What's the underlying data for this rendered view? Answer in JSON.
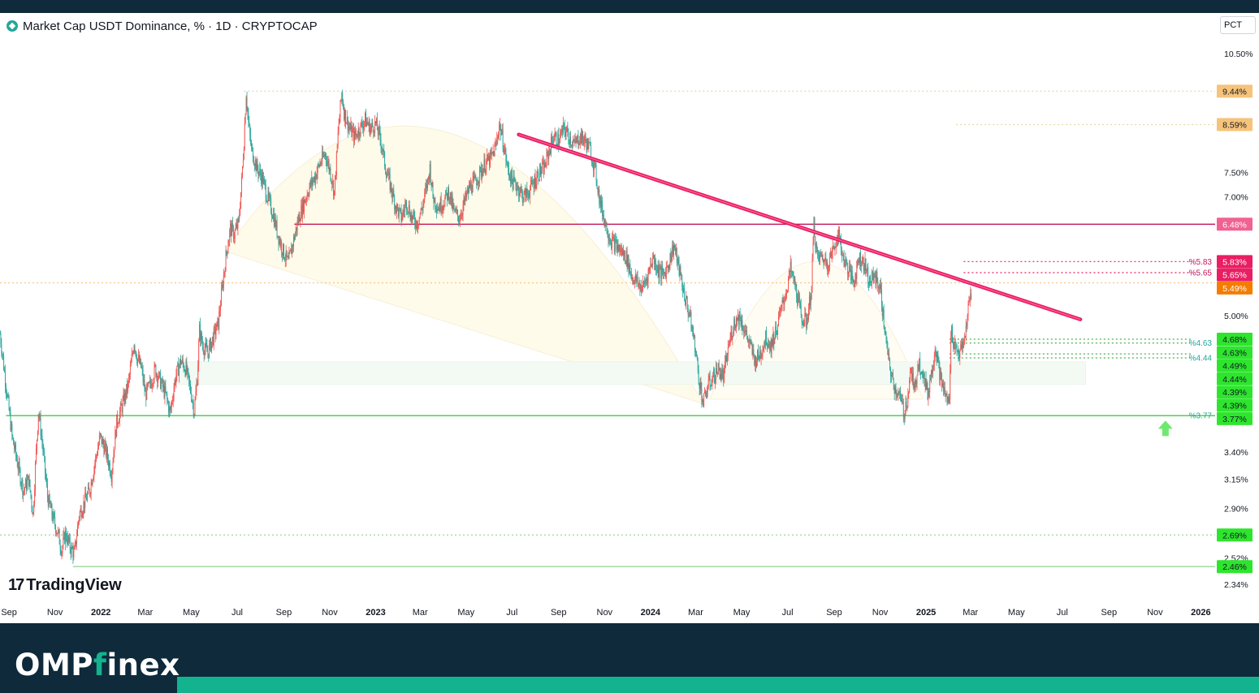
{
  "header": {
    "symbol_title": "Market Cap USDT Dominance, % · 1D · CRYPTOCAP",
    "scale_button": "PCT"
  },
  "watermark": {
    "text": "TradingView"
  },
  "footer": {
    "brand_prefix": "OMP",
    "brand_accent": "f",
    "brand_suffix": "inex"
  },
  "colors": {
    "up": "#26a69a",
    "down": "#ef5350",
    "trendline": "#e91e63",
    "support": "#4caf50",
    "resistance_box": "#c2185b",
    "footer_bg": "#0e2a3b",
    "accent": "#12b38e"
  },
  "chart_data": {
    "type": "candlestick",
    "yscale": "log",
    "ylim": [
      2.34,
      10.5
    ],
    "xlim": [
      "2021-08-20",
      "2026-01-20"
    ],
    "y_ticks": [
      "10.50%",
      "7.50%",
      "7.00%",
      "5.00%",
      "3.40%",
      "3.15%",
      "2.90%",
      "2.52%",
      "2.34%"
    ],
    "y_tick_values": [
      10.5,
      7.5,
      7.0,
      5.0,
      3.4,
      3.15,
      2.9,
      2.52,
      2.34
    ],
    "x_ticks": [
      {
        "label": "Sep",
        "date": "2021-09-01",
        "bold": false
      },
      {
        "label": "Nov",
        "date": "2021-11-01",
        "bold": false
      },
      {
        "label": "2022",
        "date": "2022-01-01",
        "bold": true
      },
      {
        "label": "Mar",
        "date": "2022-03-01",
        "bold": false
      },
      {
        "label": "May",
        "date": "2022-05-01",
        "bold": false
      },
      {
        "label": "Jul",
        "date": "2022-07-01",
        "bold": false
      },
      {
        "label": "Sep",
        "date": "2022-09-01",
        "bold": false
      },
      {
        "label": "Nov",
        "date": "2022-11-01",
        "bold": false
      },
      {
        "label": "2023",
        "date": "2023-01-01",
        "bold": true
      },
      {
        "label": "Mar",
        "date": "2023-03-01",
        "bold": false
      },
      {
        "label": "May",
        "date": "2023-05-01",
        "bold": false
      },
      {
        "label": "Jul",
        "date": "2023-07-01",
        "bold": false
      },
      {
        "label": "Sep",
        "date": "2023-09-01",
        "bold": false
      },
      {
        "label": "Nov",
        "date": "2023-11-01",
        "bold": false
      },
      {
        "label": "2024",
        "date": "2024-01-01",
        "bold": true
      },
      {
        "label": "Mar",
        "date": "2024-03-01",
        "bold": false
      },
      {
        "label": "May",
        "date": "2024-05-01",
        "bold": false
      },
      {
        "label": "Jul",
        "date": "2024-07-01",
        "bold": false
      },
      {
        "label": "Sep",
        "date": "2024-09-01",
        "bold": false
      },
      {
        "label": "Nov",
        "date": "2024-11-01",
        "bold": false
      },
      {
        "label": "2025",
        "date": "2025-01-01",
        "bold": true
      },
      {
        "label": "Mar",
        "date": "2025-03-01",
        "bold": false
      },
      {
        "label": "May",
        "date": "2025-05-01",
        "bold": false
      },
      {
        "label": "Jul",
        "date": "2025-07-01",
        "bold": false
      },
      {
        "label": "Sep",
        "date": "2025-09-01",
        "bold": false
      },
      {
        "label": "Nov",
        "date": "2025-11-01",
        "bold": false
      },
      {
        "label": "2026",
        "date": "2026-01-01",
        "bold": true
      }
    ],
    "price_path": [
      [
        "2021-08-20",
        4.75
      ],
      [
        "2021-08-28",
        4.1
      ],
      [
        "2021-09-05",
        3.55
      ],
      [
        "2021-09-12",
        3.3
      ],
      [
        "2021-09-20",
        3.05
      ],
      [
        "2021-09-27",
        3.15
      ],
      [
        "2021-10-03",
        2.85
      ],
      [
        "2021-10-10",
        3.82
      ],
      [
        "2021-10-15",
        3.5
      ],
      [
        "2021-10-22",
        3.0
      ],
      [
        "2021-10-28",
        2.85
      ],
      [
        "2021-11-05",
        2.7
      ],
      [
        "2021-11-10",
        2.58
      ],
      [
        "2021-11-15",
        2.7
      ],
      [
        "2021-11-21",
        2.6
      ],
      [
        "2021-11-27",
        2.55
      ],
      [
        "2021-12-03",
        2.85
      ],
      [
        "2021-12-10",
        2.95
      ],
      [
        "2021-12-17",
        3.05
      ],
      [
        "2021-12-24",
        3.3
      ],
      [
        "2021-12-31",
        3.55
      ],
      [
        "2022-01-08",
        3.4
      ],
      [
        "2022-01-15",
        3.2
      ],
      [
        "2022-01-22",
        3.7
      ],
      [
        "2022-01-30",
        3.9
      ],
      [
        "2022-02-06",
        4.1
      ],
      [
        "2022-02-10",
        4.35
      ],
      [
        "2022-02-14",
        4.65
      ],
      [
        "2022-02-18",
        4.45
      ],
      [
        "2022-02-24",
        4.3
      ],
      [
        "2022-03-01",
        4.0
      ],
      [
        "2022-03-07",
        4.1
      ],
      [
        "2022-03-14",
        4.3
      ],
      [
        "2022-03-21",
        4.15
      ],
      [
        "2022-03-28",
        4.0
      ],
      [
        "2022-04-03",
        3.8
      ],
      [
        "2022-04-10",
        4.2
      ],
      [
        "2022-04-17",
        4.4
      ],
      [
        "2022-04-24",
        4.3
      ],
      [
        "2022-04-30",
        4.05
      ],
      [
        "2022-05-05",
        3.82
      ],
      [
        "2022-05-09",
        4.2
      ],
      [
        "2022-05-12",
        4.8
      ],
      [
        "2022-05-16",
        4.6
      ],
      [
        "2022-05-23",
        4.5
      ],
      [
        "2022-05-30",
        4.7
      ],
      [
        "2022-06-06",
        4.9
      ],
      [
        "2022-06-12",
        5.5
      ],
      [
        "2022-06-17",
        6.0
      ],
      [
        "2022-06-22",
        6.4
      ],
      [
        "2022-06-27",
        6.3
      ],
      [
        "2022-07-03",
        6.5
      ],
      [
        "2022-07-07",
        7.3
      ],
      [
        "2022-07-10",
        8.2
      ],
      [
        "2022-07-13",
        9.4
      ],
      [
        "2022-07-16",
        8.6
      ],
      [
        "2022-07-20",
        8.0
      ],
      [
        "2022-07-27",
        7.6
      ],
      [
        "2022-08-03",
        7.4
      ],
      [
        "2022-08-10",
        7.0
      ],
      [
        "2022-08-17",
        6.7
      ],
      [
        "2022-08-24",
        6.3
      ],
      [
        "2022-08-31",
        6.0
      ],
      [
        "2022-09-07",
        5.8
      ],
      [
        "2022-09-14",
        6.2
      ],
      [
        "2022-09-21",
        6.6
      ],
      [
        "2022-09-28",
        6.9
      ],
      [
        "2022-10-05",
        7.2
      ],
      [
        "2022-10-12",
        7.4
      ],
      [
        "2022-10-19",
        7.7
      ],
      [
        "2022-10-26",
        7.9
      ],
      [
        "2022-11-02",
        7.5
      ],
      [
        "2022-11-07",
        7.1
      ],
      [
        "2022-11-10",
        7.8
      ],
      [
        "2022-11-13",
        8.6
      ],
      [
        "2022-11-17",
        9.4
      ],
      [
        "2022-11-20",
        8.9
      ],
      [
        "2022-11-27",
        8.5
      ],
      [
        "2022-12-04",
        8.3
      ],
      [
        "2022-12-11",
        8.5
      ],
      [
        "2022-12-18",
        8.7
      ],
      [
        "2022-12-25",
        8.5
      ],
      [
        "2023-01-01",
        8.6
      ],
      [
        "2023-01-08",
        8.2
      ],
      [
        "2023-01-14",
        7.6
      ],
      [
        "2023-01-21",
        7.2
      ],
      [
        "2023-01-28",
        6.8
      ],
      [
        "2023-02-04",
        6.6
      ],
      [
        "2023-02-11",
        6.9
      ],
      [
        "2023-02-18",
        6.6
      ],
      [
        "2023-02-25",
        6.5
      ],
      [
        "2023-03-04",
        6.8
      ],
      [
        "2023-03-11",
        7.3
      ],
      [
        "2023-03-14",
        7.6
      ],
      [
        "2023-03-18",
        7.0
      ],
      [
        "2023-03-25",
        6.8
      ],
      [
        "2023-04-01",
        6.9
      ],
      [
        "2023-04-08",
        7.1
      ],
      [
        "2023-04-15",
        6.7
      ],
      [
        "2023-04-22",
        6.6
      ],
      [
        "2023-04-29",
        6.9
      ],
      [
        "2023-05-06",
        7.2
      ],
      [
        "2023-05-13",
        7.3
      ],
      [
        "2023-05-20",
        7.5
      ],
      [
        "2023-05-27",
        7.7
      ],
      [
        "2023-06-03",
        7.8
      ],
      [
        "2023-06-10",
        8.1
      ],
      [
        "2023-06-14",
        8.6
      ],
      [
        "2023-06-18",
        8.3
      ],
      [
        "2023-06-25",
        7.6
      ],
      [
        "2023-07-02",
        7.3
      ],
      [
        "2023-07-09",
        7.2
      ],
      [
        "2023-07-16",
        7.0
      ],
      [
        "2023-07-23",
        7.1
      ],
      [
        "2023-07-30",
        7.3
      ],
      [
        "2023-08-06",
        7.5
      ],
      [
        "2023-08-13",
        7.6
      ],
      [
        "2023-08-18",
        7.9
      ],
      [
        "2023-08-25",
        8.3
      ],
      [
        "2023-09-01",
        8.2
      ],
      [
        "2023-09-08",
        8.5
      ],
      [
        "2023-09-15",
        8.3
      ],
      [
        "2023-09-22",
        8.1
      ],
      [
        "2023-09-29",
        8.3
      ],
      [
        "2023-10-06",
        8.2
      ],
      [
        "2023-10-13",
        8.0
      ],
      [
        "2023-10-20",
        7.5
      ],
      [
        "2023-10-26",
        6.9
      ],
      [
        "2023-11-02",
        6.5
      ],
      [
        "2023-11-09",
        6.2
      ],
      [
        "2023-11-16",
        6.1
      ],
      [
        "2023-11-23",
        6.0
      ],
      [
        "2023-11-30",
        5.9
      ],
      [
        "2023-12-07",
        5.6
      ],
      [
        "2023-12-14",
        5.5
      ],
      [
        "2023-12-21",
        5.4
      ],
      [
        "2023-12-28",
        5.6
      ],
      [
        "2024-01-04",
        5.9
      ],
      [
        "2024-01-11",
        5.7
      ],
      [
        "2024-01-18",
        5.6
      ],
      [
        "2024-01-25",
        5.8
      ],
      [
        "2024-02-01",
        6.1
      ],
      [
        "2024-02-08",
        5.7
      ],
      [
        "2024-02-15",
        5.3
      ],
      [
        "2024-02-22",
        5.0
      ],
      [
        "2024-02-29",
        4.6
      ],
      [
        "2024-03-05",
        4.2
      ],
      [
        "2024-03-11",
        3.9
      ],
      [
        "2024-03-17",
        4.1
      ],
      [
        "2024-03-24",
        4.2
      ],
      [
        "2024-03-31",
        4.3
      ],
      [
        "2024-04-07",
        4.2
      ],
      [
        "2024-04-14",
        4.6
      ],
      [
        "2024-04-21",
        4.9
      ],
      [
        "2024-04-28",
        5.0
      ],
      [
        "2024-05-05",
        4.8
      ],
      [
        "2024-05-12",
        4.6
      ],
      [
        "2024-05-19",
        4.4
      ],
      [
        "2024-05-26",
        4.5
      ],
      [
        "2024-06-02",
        4.7
      ],
      [
        "2024-06-09",
        4.6
      ],
      [
        "2024-06-16",
        4.8
      ],
      [
        "2024-06-23",
        5.1
      ],
      [
        "2024-06-30",
        5.4
      ],
      [
        "2024-07-05",
        5.7
      ],
      [
        "2024-07-12",
        5.4
      ],
      [
        "2024-07-19",
        5.0
      ],
      [
        "2024-07-26",
        4.9
      ],
      [
        "2024-08-02",
        5.4
      ],
      [
        "2024-08-05",
        6.5
      ],
      [
        "2024-08-09",
        5.9
      ],
      [
        "2024-08-16",
        5.9
      ],
      [
        "2024-08-23",
        5.8
      ],
      [
        "2024-08-30",
        6.0
      ],
      [
        "2024-09-06",
        6.3
      ],
      [
        "2024-09-13",
        5.9
      ],
      [
        "2024-09-20",
        5.7
      ],
      [
        "2024-09-27",
        5.5
      ],
      [
        "2024-10-04",
        5.9
      ],
      [
        "2024-10-11",
        5.8
      ],
      [
        "2024-10-18",
        5.5
      ],
      [
        "2024-10-25",
        5.6
      ],
      [
        "2024-11-01",
        5.4
      ],
      [
        "2024-11-06",
        4.9
      ],
      [
        "2024-11-12",
        4.4
      ],
      [
        "2024-11-19",
        4.1
      ],
      [
        "2024-11-26",
        4.0
      ],
      [
        "2024-12-03",
        3.8
      ],
      [
        "2024-12-08",
        4.0
      ],
      [
        "2024-12-12",
        4.3
      ],
      [
        "2024-12-17",
        4.0
      ],
      [
        "2024-12-21",
        4.4
      ],
      [
        "2024-12-27",
        4.3
      ],
      [
        "2025-01-03",
        4.0
      ],
      [
        "2025-01-09",
        4.3
      ],
      [
        "2025-01-13",
        4.6
      ],
      [
        "2025-01-20",
        4.2
      ],
      [
        "2025-01-26",
        4.0
      ],
      [
        "2025-02-01",
        3.9
      ],
      [
        "2025-02-03",
        4.8
      ],
      [
        "2025-02-08",
        4.6
      ],
      [
        "2025-02-14",
        4.5
      ],
      [
        "2025-02-20",
        4.6
      ],
      [
        "2025-02-25",
        5.0
      ],
      [
        "2025-03-01",
        5.3
      ],
      [
        "2025-03-03",
        5.2
      ]
    ],
    "trendline": {
      "start": [
        "2023-07-10",
        8.35
      ],
      "end": [
        "2025-07-25",
        4.95
      ]
    },
    "horizontal_levels": [
      {
        "price": 9.44,
        "label": "9.44%",
        "label_bg": "#f6c37a",
        "line": "#e6d9a7",
        "dotted": true,
        "x_start": "2022-07-10"
      },
      {
        "price": 8.59,
        "label": "8.59%",
        "label_bg": "#f6c37a",
        "line": "#e6d9a7",
        "dotted": true,
        "x_start": "2025-02-10"
      },
      {
        "price": 6.48,
        "label": "6.48%",
        "label_bg": "#f06292",
        "line": "#c2185b",
        "dotted": false,
        "x_start": "2022-09-15"
      },
      {
        "price": 5.83,
        "label": "5.83%",
        "label_bg": "#e91e63",
        "line": "#e91e63",
        "dotted": true,
        "x_start": "2025-02-20",
        "x_end": "2025-12-20"
      },
      {
        "price": 5.65,
        "label": "5.65%",
        "label_bg": "#e91e63",
        "line": "#e91e63",
        "dotted": true,
        "x_start": "2025-02-20",
        "x_end": "2025-12-20"
      },
      {
        "price": 5.49,
        "label": "5.49%",
        "label_bg": "#f57c00",
        "line": "#f5c58a",
        "dotted": true,
        "x_start": "2021-08-20"
      },
      {
        "price": 4.68,
        "label": "4.68%",
        "label_bg": "#2ee52e",
        "line": "#4caf50",
        "dotted": true,
        "x_start": "2025-02-01",
        "x_end": "2025-12-20"
      },
      {
        "price": 4.63,
        "label": "4.63%",
        "label_bg": "#2ee52e",
        "line": "#4caf50",
        "dotted": true,
        "x_start": "2025-02-01",
        "x_end": "2025-12-20"
      },
      {
        "price": 4.49,
        "label": "4.49%",
        "label_bg": "#2ee52e",
        "line": "#4caf50",
        "dotted": true,
        "x_start": "2025-02-01",
        "x_end": "2025-12-20"
      },
      {
        "price": 4.44,
        "label": "4.44%",
        "label_bg": "#2ee52e",
        "line": "#4caf50",
        "dotted": true,
        "x_start": "2025-02-01",
        "x_end": "2025-12-20"
      },
      {
        "price": 4.39,
        "label": "4.39%",
        "label_bg": "#2ee52e",
        "line": null
      },
      {
        "price": 4.39,
        "label": "4.39%",
        "label_bg": "#2ee52e",
        "line": null
      },
      {
        "price": 3.77,
        "label": "3.77%",
        "label_bg": "#2ee52e",
        "line": "#43c943",
        "dotted": false,
        "x_start": "2021-08-28"
      },
      {
        "price": 2.69,
        "label": "2.69%",
        "label_bg": "#2ee52e",
        "line": "#9ad89a",
        "dotted": true,
        "x_start": "2021-08-20"
      },
      {
        "price": 2.46,
        "label": "2.46%",
        "label_bg": "#2ee52e",
        "line": "#9ad89a",
        "dotted": false,
        "x_start": "2021-11-25"
      }
    ],
    "annotations": [
      {
        "text": "%5.83",
        "price": 5.83,
        "color": "#c2185b"
      },
      {
        "text": "%5.65",
        "price": 5.65,
        "color": "#c2185b"
      },
      {
        "text": "%4.63",
        "price": 4.63,
        "color": "#26a69a"
      },
      {
        "text": "%4.44",
        "price": 4.44,
        "color": "#26a69a"
      },
      {
        "text": "%3.77",
        "price": 3.77,
        "color": "#26a69a"
      }
    ],
    "arrow": {
      "date": "2025-11-15",
      "price": 3.6,
      "direction": "up",
      "color": "#6ee86e"
    }
  }
}
